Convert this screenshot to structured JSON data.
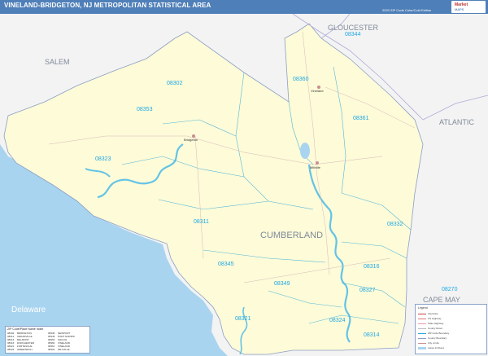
{
  "header": {
    "title": "VINELAND-BRIDGETON, NJ METROPOLITAN STATISTICAL AREA",
    "edition": "2023 ZIP Code Color/Cold Edition",
    "logo_text": "Market",
    "logo_sub": "MAPS"
  },
  "counties": {
    "salem": "SALEM",
    "gloucester": "GLOUCESTER",
    "atlantic": "ATLANTIC",
    "cumberland": "CUMBERLAND",
    "cape_may": "CAPE MAY"
  },
  "water": {
    "delaware": "Delaware"
  },
  "zips": [
    "08344",
    "08360",
    "08302",
    "08353",
    "08361",
    "08323",
    "08311",
    "08332",
    "08345",
    "08316",
    "08349",
    "08327",
    "08270",
    "08321",
    "08324",
    "08314"
  ],
  "cities": {
    "vineland": "Vineland",
    "millville": "Millville",
    "bridgeton": "Bridgeton"
  },
  "legend": {
    "title": "Legend",
    "rows": [
      "Interstate",
      "US Highway",
      "State Highway",
      "County Road",
      "ZIP Code Boundary",
      "County Boundary",
      "City Limits",
      "Lakes & Rivers"
    ]
  },
  "zip_table": {
    "title": "ZIP Code/Place Name Index",
    "rows": [
      [
        "08302",
        "BRIDGETON",
        "08345",
        "NEWPORT"
      ],
      [
        "08311",
        "CEDARVILLE",
        "08349",
        "PORT NORRIS"
      ],
      [
        "08314",
        "DELMONT",
        "08353",
        "SHILOH"
      ],
      [
        "08316",
        "DORCHESTER",
        "08360",
        "VINELAND"
      ],
      [
        "08321",
        "FORTESCUE",
        "08361",
        "VINELAND"
      ],
      [
        "08323",
        "GREENWICH",
        "08332",
        "MILLVILLE"
      ]
    ]
  },
  "colors": {
    "land": "#fdfbd8",
    "water": "#a9d4ef",
    "outside": "#f2f2f2",
    "border": "#8b9ec4",
    "river": "#64c3e6",
    "zip_line": "#2aa6d8",
    "header": "#4f7fb8"
  }
}
